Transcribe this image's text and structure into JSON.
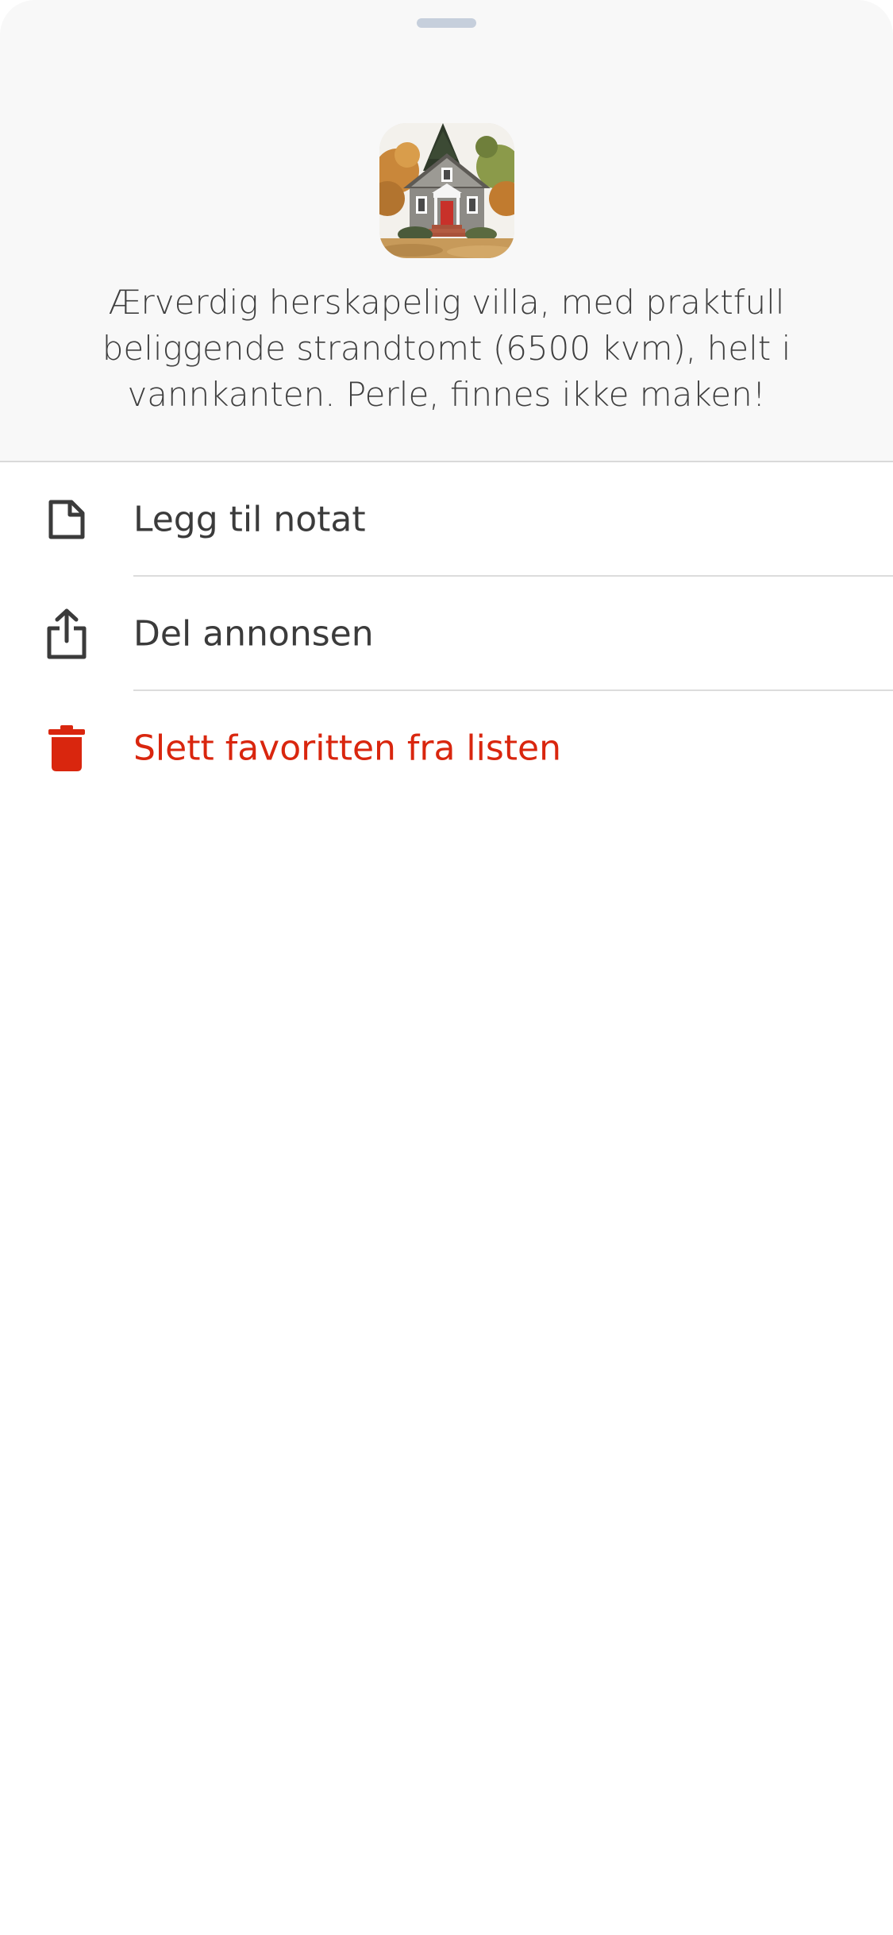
{
  "listing": {
    "title": "Ærverdig herskapelig villa, med praktfull beliggende strandtomt (6500 kvm), helt i vannkanten. Perle, finnes ikke maken!",
    "thumbnail_icon": "house-photo"
  },
  "actions": {
    "add_note": {
      "label": "Legg til notat",
      "icon": "note-icon"
    },
    "share": {
      "label": "Del annonsen",
      "icon": "share-icon"
    },
    "delete": {
      "label": "Slett favoritten fra listen",
      "icon": "trash-icon"
    }
  },
  "colors": {
    "header_bg": "#f8f8f8",
    "text": "#3b3b3b",
    "danger": "#d9260e",
    "handle": "#c6cfdc"
  }
}
